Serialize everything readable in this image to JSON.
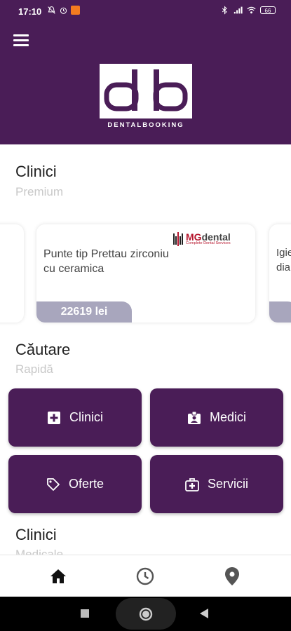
{
  "status_bar": {
    "time": "17:10",
    "battery": "66",
    "icons_left": [
      "mute-icon",
      "alarm-icon",
      "app-notification-icon"
    ],
    "icons_right": [
      "bluetooth-icon",
      "signal-icon",
      "wifi-icon",
      "battery-icon"
    ]
  },
  "header": {
    "logo_text": "DENTALBOOKING",
    "background_color": "#4a1d57"
  },
  "premium_section": {
    "title": "Clinici",
    "subtitle": "Premium",
    "cards": [
      {
        "description": "Punte tip Prettau zirconiu cu ceramica",
        "price": "22619 lei",
        "brand": {
          "prefix": "MG",
          "name": "dental",
          "tagline": "Complete Dental Services"
        }
      },
      {
        "description": "Igie ved dia par"
      }
    ]
  },
  "search_section": {
    "title": "Căutare",
    "subtitle": "Rapidă",
    "buttons": [
      {
        "label": "Clinici",
        "icon": "plus-square-icon"
      },
      {
        "label": "Medici",
        "icon": "badge-icon"
      },
      {
        "label": "Oferte",
        "icon": "tag-icon"
      },
      {
        "label": "Servicii",
        "icon": "first-aid-icon"
      }
    ]
  },
  "medical_section": {
    "title": "Clinici",
    "subtitle": "Medicale"
  },
  "bottom_nav": {
    "items": [
      {
        "icon": "home-icon",
        "active": true
      },
      {
        "icon": "history-icon",
        "active": false
      },
      {
        "icon": "location-pin-icon",
        "active": false
      }
    ]
  },
  "colors": {
    "accent": "#4a1d57",
    "badge": "#a8a6bd",
    "brand_red": "#b6162e"
  }
}
